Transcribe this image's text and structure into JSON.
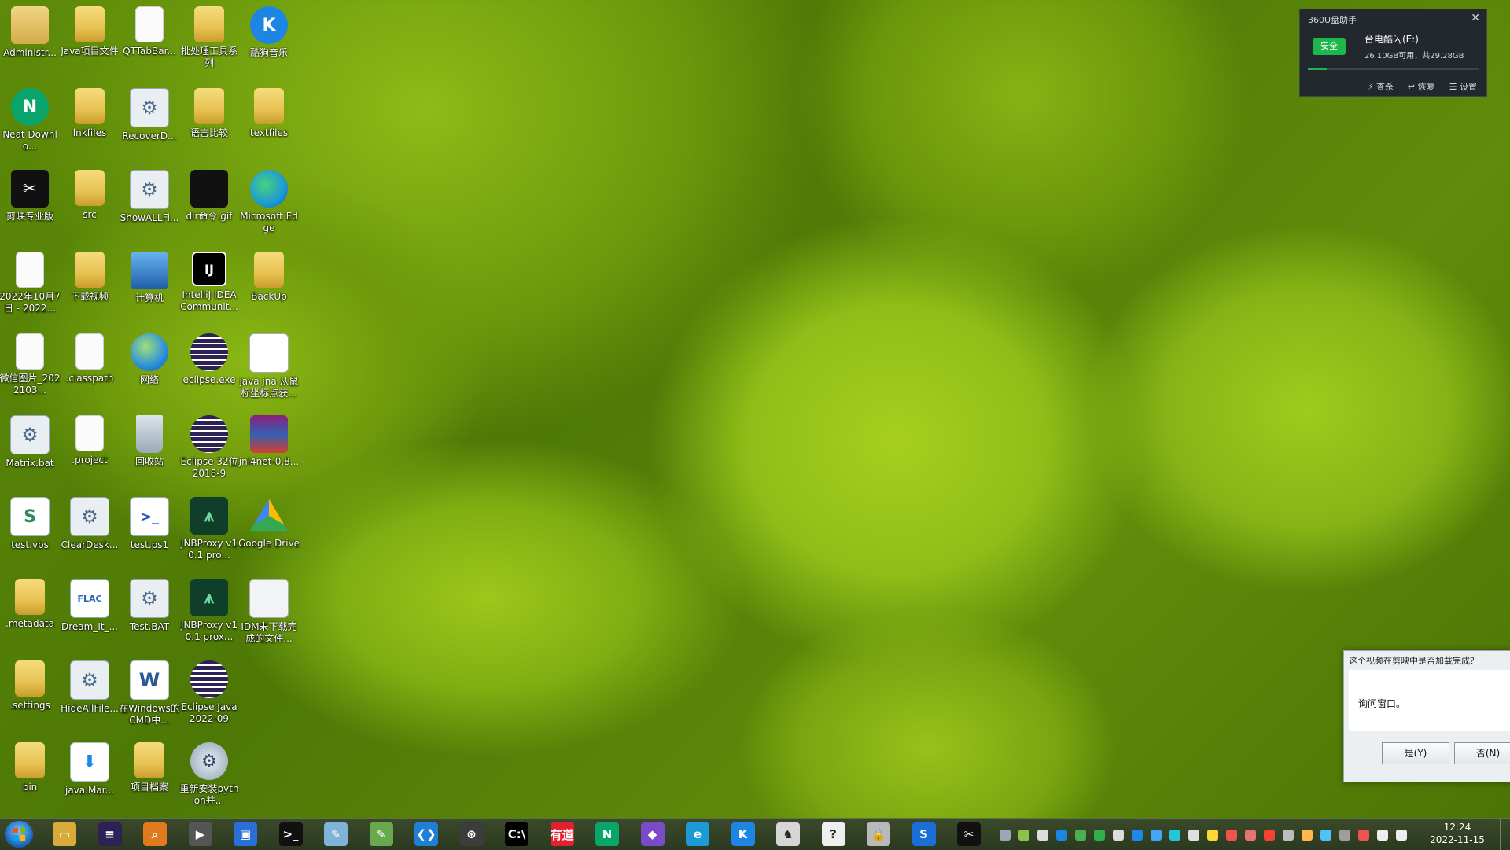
{
  "desktop": {
    "icons": [
      {
        "label": "Administr...",
        "glyph": "",
        "name": "user-folder-icon"
      },
      {
        "label": "Java项目文件",
        "glyph": "",
        "name": "folder-icon"
      },
      {
        "label": "QTTabBar...",
        "glyph": "",
        "name": "file-icon"
      },
      {
        "label": "批处理工具系列",
        "glyph": "",
        "name": "folder-icon"
      },
      {
        "label": "酷狗音乐",
        "glyph": "K",
        "name": "kugou-music-icon"
      },
      {
        "label": "Neat Downlo...",
        "glyph": "N",
        "name": "neat-download-icon"
      },
      {
        "label": "lnkfiles",
        "glyph": "",
        "name": "folder-icon"
      },
      {
        "label": "RecoverD...",
        "glyph": "⚙",
        "name": "batch-file-icon"
      },
      {
        "label": "语言比较",
        "glyph": "",
        "name": "folder-icon"
      },
      {
        "label": "textfiles",
        "glyph": "",
        "name": "folder-icon"
      },
      {
        "label": "剪映专业版",
        "glyph": "✂",
        "name": "jianying-icon"
      },
      {
        "label": "src",
        "glyph": "",
        "name": "folder-icon"
      },
      {
        "label": "ShowALLFi...",
        "glyph": "⚙",
        "name": "batch-file-icon"
      },
      {
        "label": "dir命令.gif",
        "glyph": "",
        "name": "gif-image-icon"
      },
      {
        "label": "Microsoft Edge",
        "glyph": "",
        "name": "edge-browser-icon"
      },
      {
        "label": "2022年10月7日 - 2022...",
        "glyph": "",
        "name": "file-icon"
      },
      {
        "label": "下载视频",
        "glyph": "",
        "name": "folder-icon"
      },
      {
        "label": "计算机",
        "glyph": "",
        "name": "computer-icon"
      },
      {
        "label": "IntelliJ IDEA Communit...",
        "glyph": "IJ",
        "name": "intellij-idea-icon"
      },
      {
        "label": "BackUp",
        "glyph": "",
        "name": "folder-icon"
      },
      {
        "label": "微信图片_2022103...",
        "glyph": "",
        "name": "image-file-icon"
      },
      {
        "label": ".classpath",
        "glyph": "",
        "name": "file-icon"
      },
      {
        "label": "网络",
        "glyph": "",
        "name": "network-icon"
      },
      {
        "label": "eclipse.exe",
        "glyph": "",
        "name": "eclipse-icon"
      },
      {
        "label": "java jna 从鼠标坐标点获...",
        "glyph": "",
        "name": "document-file-icon"
      },
      {
        "label": "Matrix.bat",
        "glyph": "⚙",
        "name": "batch-file-icon"
      },
      {
        "label": ".project",
        "glyph": "",
        "name": "file-icon"
      },
      {
        "label": "回收站",
        "glyph": "",
        "name": "recycle-bin-icon"
      },
      {
        "label": "Eclipse 32位 2018-9",
        "glyph": "",
        "name": "eclipse-icon"
      },
      {
        "label": "jni4net-0.8...",
        "glyph": "",
        "name": "winrar-archive-icon"
      },
      {
        "label": "test.vbs",
        "glyph": "S",
        "name": "vbs-script-icon"
      },
      {
        "label": "ClearDesk...",
        "glyph": "⚙",
        "name": "batch-file-icon"
      },
      {
        "label": "test.ps1",
        "glyph": ">_",
        "name": "powershell-script-icon"
      },
      {
        "label": "JNBProxy v10.1 pro...",
        "glyph": "⩚",
        "name": "jnbproxy-icon"
      },
      {
        "label": "Google Drive",
        "glyph": "",
        "name": "google-drive-icon"
      },
      {
        "label": ".metadata",
        "glyph": "",
        "name": "folder-icon"
      },
      {
        "label": "Dream_It_...",
        "glyph": "FLAC",
        "name": "flac-audio-icon"
      },
      {
        "label": "Test.BAT",
        "glyph": "⚙",
        "name": "batch-file-icon"
      },
      {
        "label": "JNBProxy v10.1 prox...",
        "glyph": "⩚",
        "name": "jnbproxy-icon"
      },
      {
        "label": "IDM未下载完成的文件...",
        "glyph": "",
        "name": "idm-file-icon"
      },
      {
        "label": ".settings",
        "glyph": "",
        "name": "folder-icon"
      },
      {
        "label": "HideAllFile...",
        "glyph": "⚙",
        "name": "batch-file-icon"
      },
      {
        "label": "在Windows的CMD中...",
        "glyph": "W",
        "name": "word-document-icon"
      },
      {
        "label": "Eclipse Java 2022-09",
        "glyph": "",
        "name": "eclipse-icon"
      },
      {
        "label": "",
        "glyph": "",
        "name": "empty-slot"
      },
      {
        "label": "bin",
        "glyph": "",
        "name": "folder-icon"
      },
      {
        "label": "java.Mar...",
        "glyph": "⬇",
        "name": "download-file-icon"
      },
      {
        "label": "项目档案",
        "glyph": "",
        "name": "folder-icon"
      },
      {
        "label": "重新安装python并...",
        "glyph": "⚙",
        "name": "setup-file-icon"
      }
    ]
  },
  "usb_helper": {
    "title": "360U盘助手",
    "close": "✕",
    "status": "安全",
    "drive": "台电酷闪(E:)",
    "space": "26.10GB可用，共29.28GB",
    "used_fraction": 0.11,
    "actions": [
      "⚡ 查杀",
      "↩ 恢复",
      "☰ 设置"
    ]
  },
  "dialog": {
    "title": "这个视频在剪映中是否加载完成？",
    "message": "询问窗口。",
    "yes": "是(Y)",
    "no": "否(N)"
  },
  "taskbar": {
    "apps": [
      {
        "name": "file-explorer-icon",
        "glyph": "▭",
        "color": "#d9a93a"
      },
      {
        "name": "eclipse-taskbar-icon",
        "glyph": "≡",
        "color": "#2c2255"
      },
      {
        "name": "everything-search-icon",
        "glyph": "⌕",
        "color": "#e07a1f"
      },
      {
        "name": "video-editor-icon",
        "glyph": "▶",
        "color": "#555555"
      },
      {
        "name": "bitwarden-icon",
        "glyph": "▣",
        "color": "#2a6fd6"
      },
      {
        "name": "terminal-icon",
        "glyph": ">_",
        "color": "#111111"
      },
      {
        "name": "notepad-icon",
        "glyph": "✎",
        "color": "#7fb3d9"
      },
      {
        "name": "text-editor-icon",
        "glyph": "✎",
        "color": "#6aa84f"
      },
      {
        "name": "vscode-icon",
        "glyph": "❮❯",
        "color": "#1f7fd6"
      },
      {
        "name": "network-tool-icon",
        "glyph": "⊛",
        "color": "#3c3c3c"
      },
      {
        "name": "cmd-icon",
        "glyph": "C:\\",
        "color": "#000000"
      },
      {
        "name": "youdao-dict-icon",
        "glyph": "有道",
        "color": "#e3202d"
      },
      {
        "name": "neat-download-taskbar-icon",
        "glyph": "N",
        "color": "#0aa56a"
      },
      {
        "name": "visual-studio-icon",
        "glyph": "◆",
        "color": "#7b4bc7"
      },
      {
        "name": "edge-taskbar-icon",
        "glyph": "e",
        "color": "#1c9ad6"
      },
      {
        "name": "kugou-taskbar-icon",
        "glyph": "K",
        "color": "#1d86e4"
      },
      {
        "name": "game-app-icon",
        "glyph": "♞",
        "color": "#d6d6d6"
      },
      {
        "name": "help-icon",
        "glyph": "?",
        "color": "#efefef"
      },
      {
        "name": "lock-tool-icon",
        "glyph": "🔒",
        "color": "#b9b9b9"
      },
      {
        "name": "sogou-input-icon",
        "glyph": "S",
        "color": "#1a6fd6"
      },
      {
        "name": "jianying-taskbar-icon",
        "glyph": "✂",
        "color": "#111111"
      }
    ],
    "tray": [
      {
        "name": "keyboard-tray-icon",
        "color": "#9aa7b4"
      },
      {
        "name": "battery-tray-icon",
        "color": "#8bc34a"
      },
      {
        "name": "bluetooth-tray-icon",
        "color": "#dddddd"
      },
      {
        "name": "kugou-tray-icon",
        "color": "#1d86e4"
      },
      {
        "name": "app-tray-icon",
        "color": "#4caf50"
      },
      {
        "name": "360-tray-icon",
        "color": "#2eb34a"
      },
      {
        "name": "usb-tray-icon",
        "color": "#dddddd"
      },
      {
        "name": "qq-tray-icon",
        "color": "#1e88e5"
      },
      {
        "name": "chat-tray-icon",
        "color": "#42a5f5"
      },
      {
        "name": "edge-tray-icon",
        "color": "#26c6da"
      },
      {
        "name": "telegram-tray-icon",
        "color": "#e0e0e0"
      },
      {
        "name": "update-tray-icon",
        "color": "#fdd835"
      },
      {
        "name": "mail-tray-icon",
        "color": "#ef5350"
      },
      {
        "name": "java-tray-icon",
        "color": "#e57373"
      },
      {
        "name": "shield-tray-icon",
        "color": "#f44336"
      },
      {
        "name": "tool-tray-icon",
        "color": "#bdbdbd"
      },
      {
        "name": "search-tray-icon",
        "color": "#ffb74d"
      },
      {
        "name": "sync-tray-icon",
        "color": "#4fc3f7"
      },
      {
        "name": "flag-tray-icon",
        "color": "#9e9e9e"
      },
      {
        "name": "speaker-mute-tray-icon",
        "color": "#ef5350"
      },
      {
        "name": "volume-tray-icon",
        "color": "#eeeeee"
      },
      {
        "name": "signal-tray-icon",
        "color": "#eeeeee"
      }
    ],
    "time": "12:24",
    "date": "2022-11-15"
  }
}
